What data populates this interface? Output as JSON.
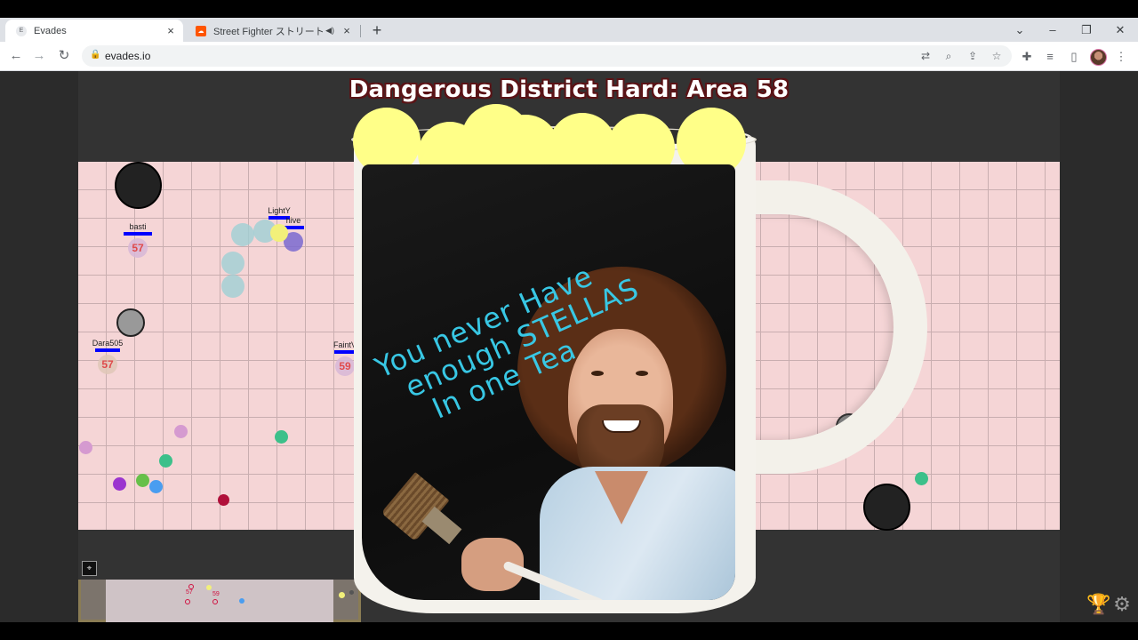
{
  "browser": {
    "tabs": [
      {
        "title": "Evades",
        "favicon": "E",
        "active": true
      },
      {
        "title": "Street Fighter ストリートファイタ",
        "favicon": "soundcloud",
        "audio": "speaker-icon",
        "active": false
      }
    ],
    "new_tab": "+",
    "window_controls": {
      "chevron": "⌄",
      "minimize": "–",
      "restore": "❐",
      "close": "✕"
    },
    "nav": {
      "back": "←",
      "forward": "→",
      "reload": "↻"
    },
    "url": "evades.io",
    "close_glyph": "×"
  },
  "game": {
    "area_title": "Dangerous District Hard: Area 58",
    "players": [
      {
        "name": "basti",
        "level": "57"
      },
      {
        "name": "LightY",
        "level": ""
      },
      {
        "name": "hive",
        "level": ""
      },
      {
        "name": "Dara505",
        "level": "57"
      },
      {
        "name": "FaintV",
        "level": "59"
      }
    ],
    "minimap_levels": [
      "57",
      "59"
    ],
    "colors": {
      "field": "#f5d5d6",
      "grid": "#c9aeb0",
      "outer": "#333333",
      "title_outline": "#5a1316"
    }
  },
  "mug": {
    "text_lines": [
      "You never Have",
      "enough STELLAS",
      "In one Tea"
    ],
    "text_color": "#38c7e4"
  }
}
